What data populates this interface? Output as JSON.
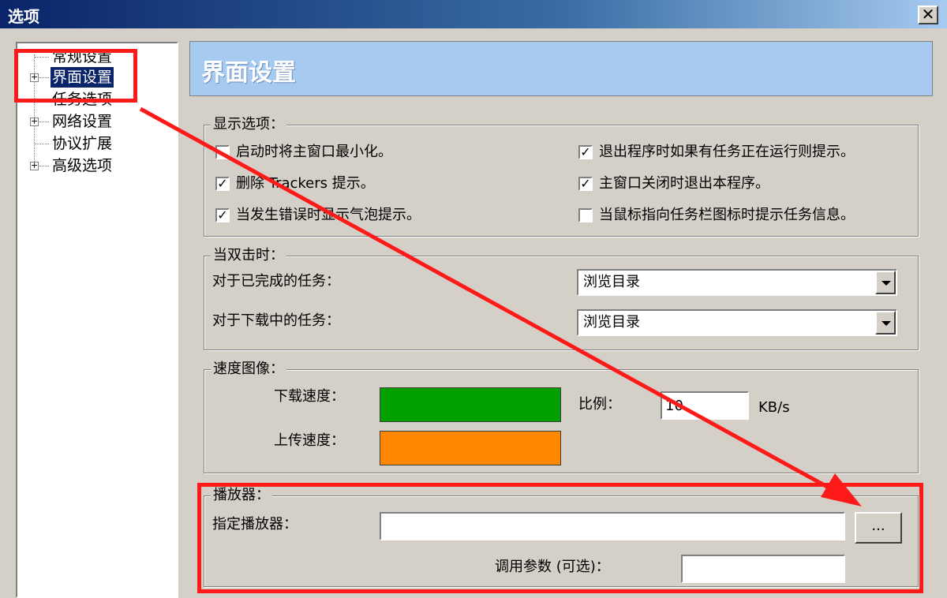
{
  "window": {
    "title": "选项",
    "close_glyph": "✕"
  },
  "tree": {
    "items": [
      {
        "label": "常规设置",
        "expandable": false
      },
      {
        "label": "界面设置",
        "expandable": true,
        "selected": true
      },
      {
        "label": "任务选项",
        "expandable": false
      },
      {
        "label": "网络设置",
        "expandable": true
      },
      {
        "label": "协议扩展",
        "expandable": false
      },
      {
        "label": "高级选项",
        "expandable": true
      }
    ],
    "expander_glyph": "+"
  },
  "banner": {
    "title": "界面设置"
  },
  "display_options": {
    "title": "显示选项：",
    "items": [
      {
        "label": "启动时将主窗口最小化。",
        "checked": false
      },
      {
        "label": "删除 Trackers 提示。",
        "checked": true
      },
      {
        "label": "当发生错误时显示气泡提示。",
        "checked": true
      },
      {
        "label": "退出程序时如果有任务正在运行则提示。",
        "checked": true
      },
      {
        "label": "主窗口关闭时退出本程序。",
        "checked": true
      },
      {
        "label": "当鼠标指向任务栏图标时提示任务信息。",
        "checked": false
      }
    ],
    "check_glyph": "✓"
  },
  "double_click": {
    "title": "当双击时：",
    "completed_label": "对于已完成的任务：",
    "completed_value": "浏览目录",
    "downloading_label": "对于下载中的任务：",
    "downloading_value": "浏览目录"
  },
  "speed_graph": {
    "title": "速度图像：",
    "download_label": "下载速度：",
    "upload_label": "上传速度：",
    "download_color": "#00a000",
    "upload_color": "#ff8800",
    "ratio_label": "比例：",
    "ratio_value": "10",
    "ratio_unit": "KB/s"
  },
  "player": {
    "title": "播放器：",
    "player_label": "指定播放器：",
    "player_value": "",
    "browse_label": "...",
    "params_label": "调用参数 (可选)：",
    "params_value": ""
  },
  "annotation": {
    "color": "#ff1a1a"
  }
}
